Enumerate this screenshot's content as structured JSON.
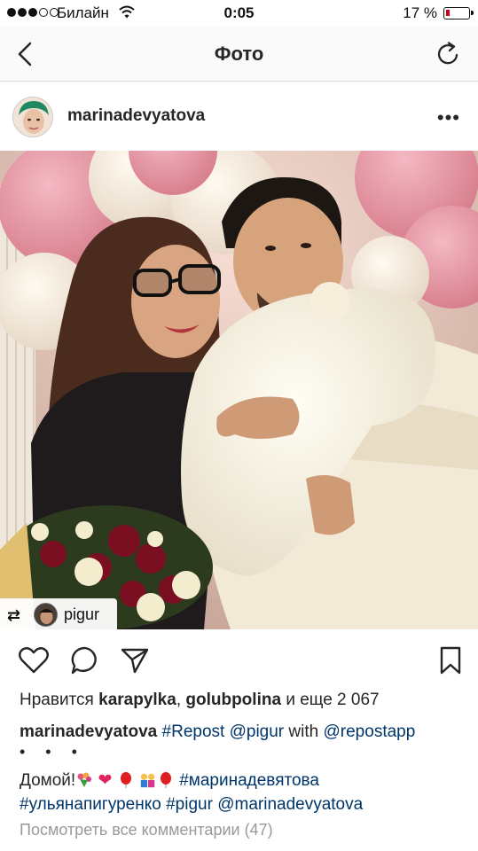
{
  "status": {
    "carrier": "Билайн",
    "time": "0:05",
    "battery": "17 %"
  },
  "nav": {
    "title": "Фото"
  },
  "post": {
    "username": "marinadevyatova",
    "repost_user": "pigur"
  },
  "likes": {
    "prefix": "Нравится",
    "user1": "karapylka",
    "sep": ",",
    "user2": "golubpolina",
    "suffix": "и еще 2 067"
  },
  "caption": {
    "username": "marinadevyatova",
    "tag1": "#Repost",
    "mention1": "@pigur",
    "word_with": "with",
    "mention2": "@repostapp",
    "dots": "• • •",
    "home": "Домой!",
    "tag2": "#маринадевятова",
    "tag3": "#ульянапигуренко",
    "tag4": "#pigur",
    "mention3": "@marinadevyatova"
  },
  "comments": {
    "view_all": "Посмотреть все комментарии (47)"
  },
  "colors": {
    "link": "#003569",
    "muted": "#999999",
    "battery_low": "#d0021b"
  }
}
